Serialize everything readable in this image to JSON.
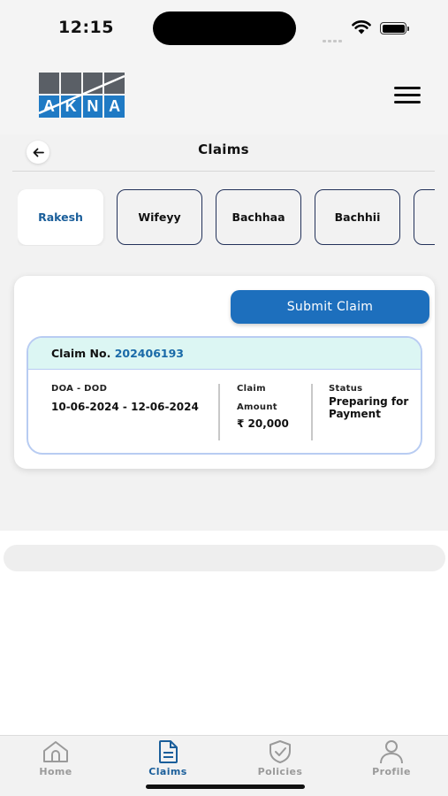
{
  "status_bar": {
    "time": "12:15"
  },
  "header": {
    "logo_letters": [
      "A",
      "K",
      "N",
      "A"
    ],
    "menu_icon": "hamburger-menu-icon"
  },
  "page": {
    "title": "Claims",
    "back_icon": "arrow-left-icon"
  },
  "members": [
    {
      "label": "Rakesh",
      "active": true
    },
    {
      "label": "Wifeyy",
      "active": false
    },
    {
      "label": "Bachhaa",
      "active": false
    },
    {
      "label": "Bachhii",
      "active": false
    },
    {
      "label": "",
      "active": false
    }
  ],
  "actions": {
    "submit_claim": "Submit Claim"
  },
  "claim": {
    "number_label": "Claim No.",
    "number": "202406193",
    "doa_dod_label": "DOA - DOD",
    "doa_dod_value": "10-06-2024 - 12-06-2024",
    "amount_label_1": "Claim",
    "amount_label_2": "Amount",
    "amount_value": "₹ 20,000",
    "status_label": "Status",
    "status_value": "Preparing for Payment"
  },
  "nav": {
    "items": [
      {
        "label": "Home",
        "icon": "home-icon",
        "active": false
      },
      {
        "label": "Claims",
        "icon": "document-icon",
        "active": true
      },
      {
        "label": "Policies",
        "icon": "shield-check-icon",
        "active": false
      },
      {
        "label": "Profile",
        "icon": "user-icon",
        "active": false
      }
    ]
  },
  "colors": {
    "accent": "#1d6fbd",
    "active_text": "#1a5e9a",
    "claim_header_bg": "#dcf6f3",
    "claim_border": "#b8ccf2",
    "tab_border": "#23325a"
  }
}
